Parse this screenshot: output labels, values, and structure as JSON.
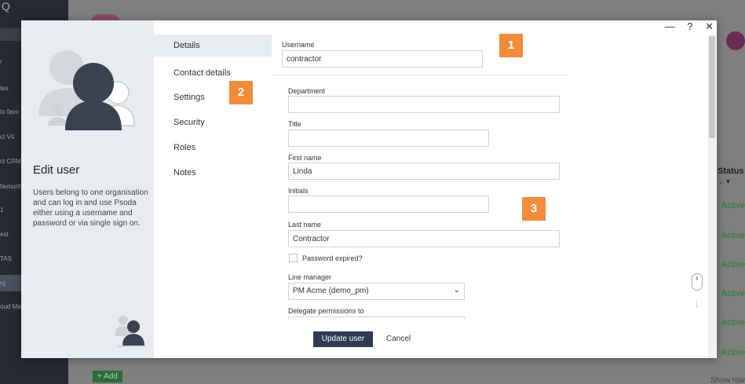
{
  "background": {
    "sidebar": {
      "logo": "Q",
      "items": [
        "r",
        "tes",
        "to favo",
        "ct V4",
        "ct CRM",
        "favourit",
        "1",
        "est",
        "TAS",
        "rg",
        "oud Ma"
      ]
    },
    "status_header": "Status",
    "status_values": [
      "Active",
      "Active",
      "Active",
      "Active",
      "Active",
      "Active"
    ],
    "add_label": "Add",
    "show_rows": "Show row"
  },
  "modal": {
    "window_controls": {
      "minimize": "—",
      "help": "?",
      "close": "✕"
    },
    "left_panel": {
      "title": "Edit user",
      "description": "Users belong to one organisation and can log in and use Psoda either using a username and password or via single sign on."
    },
    "nav": {
      "items": [
        {
          "label": "Details",
          "active": true
        },
        {
          "label": "Contact details"
        },
        {
          "label": "Settings"
        },
        {
          "label": "Security"
        },
        {
          "label": "Roles"
        },
        {
          "label": "Notes"
        }
      ]
    },
    "form": {
      "username": {
        "label": "Username",
        "value": "contractor"
      },
      "department": {
        "label": "Department",
        "value": ""
      },
      "title": {
        "label": "Title",
        "value": ""
      },
      "first_name": {
        "label": "First name",
        "value": "Linda"
      },
      "initials": {
        "label": "Initials",
        "value": ""
      },
      "last_name": {
        "label": "Last name",
        "value": "Contractor"
      },
      "password_expired": {
        "label": "Password expired?",
        "checked": false
      },
      "line_manager": {
        "label": "Line manager",
        "value": "PM Acme (demo_pm)"
      },
      "delegate": {
        "label": "Delegate permissions to"
      }
    },
    "badges": [
      "1",
      "2",
      "3"
    ],
    "footer": {
      "update_label": "Update user",
      "cancel_label": "Cancel"
    }
  },
  "colors": {
    "badge": "#f28c3a",
    "primary_button": "#2f3b4e",
    "left_panel_bg": "#e8ebf0",
    "status_green": "#2a7d2a"
  }
}
